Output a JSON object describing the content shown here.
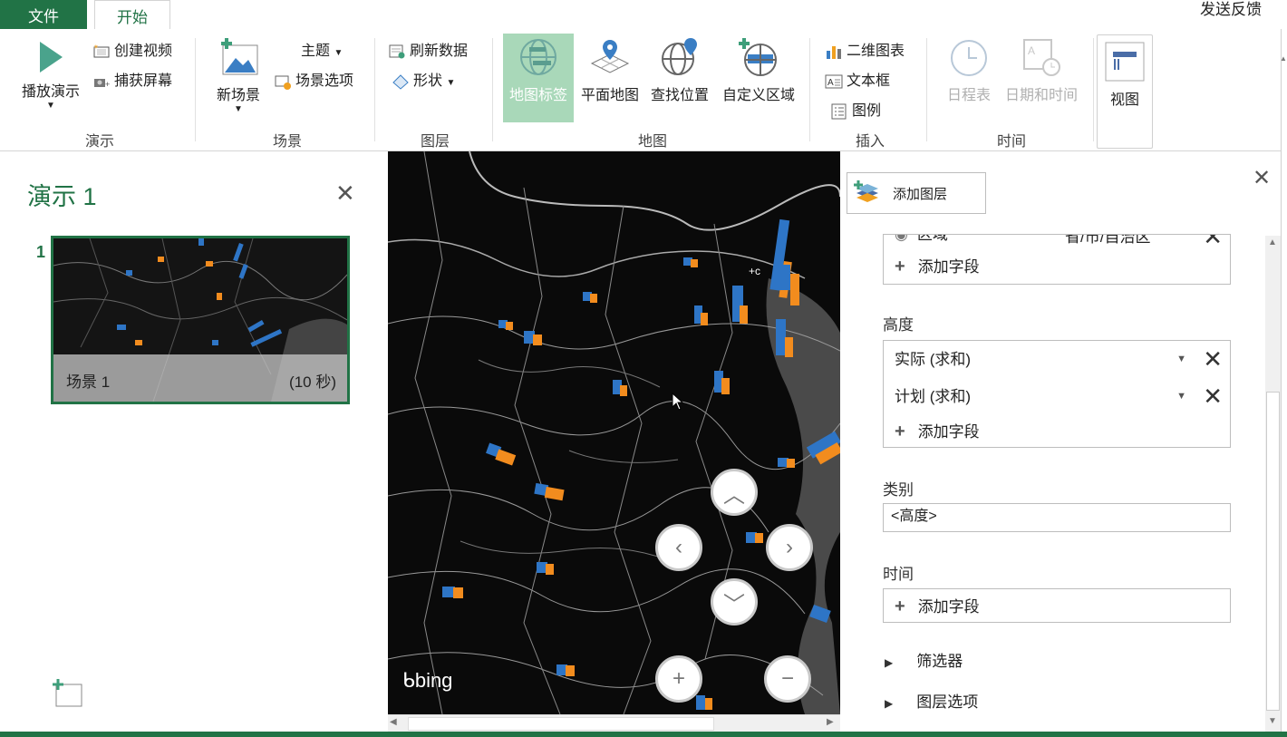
{
  "tabs": {
    "file": "文件",
    "home": "开始"
  },
  "feedback": "发送反馈",
  "ribbon": {
    "groups": {
      "tour": "演示",
      "scene": "场景",
      "layer": "图层",
      "map": "地图",
      "insert": "插入",
      "time": "时间"
    },
    "play_tour": "播放演示",
    "create_video": "创建视频",
    "capture_screen": "捕获屏幕",
    "new_scene": "新场景",
    "themes": "主题",
    "scene_options": "场景选项",
    "refresh_data": "刷新数据",
    "shapes": "形状",
    "map_labels": "地图标签",
    "flat_map": "平面地图",
    "find_location": "查找位置",
    "custom_regions": "自定义区域",
    "chart_2d": "二维图表",
    "text_box": "文本框",
    "legend": "图例",
    "timeline": "日程表",
    "date_time": "日期和时间",
    "view": "视图"
  },
  "tour_panel": {
    "title": "演示 1",
    "scene_number": "1",
    "scene_name": "场景 1",
    "scene_duration": "(10 秒)"
  },
  "map": {
    "attribution": "bing"
  },
  "layer_pane": {
    "add_layer": "添加图层",
    "location_partial": "区域",
    "location_value_partial": "省/市/自治区",
    "add_field": "添加字段",
    "height_label": "高度",
    "height_fields": [
      "实际 (求和)",
      "计划 (求和)"
    ],
    "category_label": "类别",
    "category_value": "<高度>",
    "time_label": "时间",
    "filters": "筛选器",
    "layer_options": "图层选项"
  },
  "colors": {
    "accent": "#217346",
    "series_actual": "#2e75c6",
    "series_plan": "#f28c1e"
  }
}
